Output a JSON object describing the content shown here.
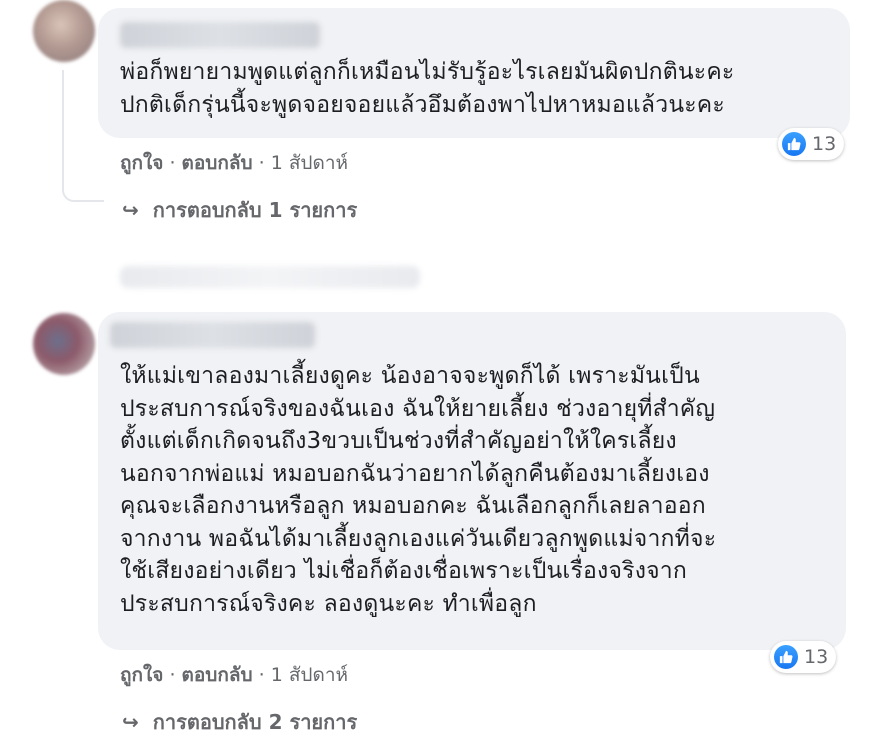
{
  "comments": [
    {
      "text": "พ่อก็พยายามพูดแต่ลูกก็เหมือนไม่รับรู้อะไรเลยมันผิดปกตินะคะ\nปกติเด็กรุ่นนี้จะพูดจอยจอยแล้วอึมต้องพาไปหาหมอแล้วนะคะ",
      "like": "ถูกใจ",
      "sep1": " · ",
      "reply": "ตอบกลับ",
      "sep2": " · ",
      "time": "1 สัปดาห์",
      "reaction_count": "13",
      "reaction_icon": "like-icon",
      "replies_label": "การตอบกลับ 1 รายการ"
    },
    {
      "text": "ให้แม่เขาลองมาเลี้ยงดูคะ น้องอาจจะพูดก็ได้ เพราะมันเป็น\nประสบการณ์จริงของฉันเอง ฉันให้ยายเลี้ยง ช่วงอายุที่สำคัญ\nตั้งแต่เด็กเกิดจนถึง3ขวบเป็นช่วงที่สำคัญอย่าให้ใครเลี้ยง\nนอกจากพ่อแม่ หมอบอกฉันว่าอยากได้ลูกคืนต้องมาเลี้ยงเอง\nคุณจะเลือกงานหรือลูก หมอบอกคะ ฉันเลือกลูกก็เลยลาออก\nจากงาน พอฉันได้มาเลี้ยงลูกเองแค่วันเดียวลูกพูดแม่จากที่จะ\nใช้เสียงอย่างเดียว ไม่เชื่อก็ต้องเชื่อเพราะเป็นเรื่องจริงจาก\nประสบการณ์จริงคะ ลองดูนะคะ ทำเพื่อลูก",
      "like": "ถูกใจ",
      "sep1": " · ",
      "reply": "ตอบกลับ",
      "sep2": " · ",
      "time": "1 สัปดาห์",
      "reaction_count": "13",
      "reaction_icon": "like-icon",
      "replies_label": "การตอบกลับ 2 รายการ"
    }
  ],
  "colors": {
    "bubble": "#f0f2f5",
    "meta": "#65676b",
    "like_blue": "#1877f2"
  }
}
